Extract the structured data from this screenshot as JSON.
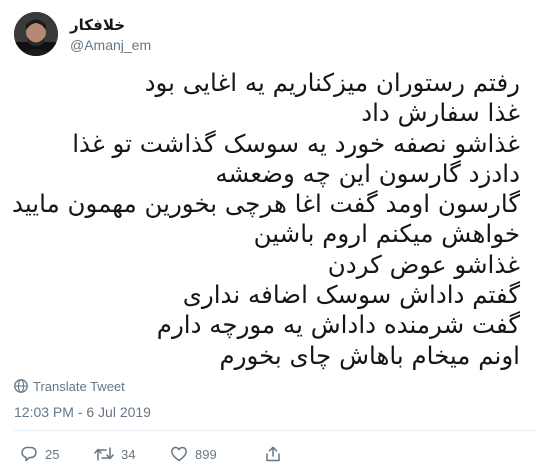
{
  "user": {
    "display_name": "خلافکار",
    "handle": "@Amanj_em"
  },
  "tweet": {
    "lines": [
      "رفتم رستوران میزکناریم یه اغایی بود",
      "غذا سفارش داد",
      "غذاشو نصفه خورد یه سوسک گذاشت تو غذا",
      "دادزد گارسون این چه وضعشه",
      "گارسون اومد گفت اغا هرچی بخورین مهمون مایید",
      "خواهش میکنم اروم باشین",
      "غذاشو عوض کردن",
      "گفتم داداش سوسک اضافه نداری",
      "گفت شرمنده داداش یه مورچه دارم",
      "اونم میخام باهاش چای بخورم"
    ],
    "translate_label": "Translate Tweet",
    "timestamp": "12:03 PM - 6 Jul 2019"
  },
  "actions": {
    "reply_count": "25",
    "retweet_count": "34",
    "like_count": "899"
  },
  "icons": {
    "reply": "reply-icon",
    "retweet": "retweet-icon",
    "like": "heart-icon",
    "share": "share-icon",
    "translate": "globe-icon"
  },
  "colors": {
    "text": "#14171a",
    "secondary": "#657786",
    "divider": "#e6ecf0"
  }
}
